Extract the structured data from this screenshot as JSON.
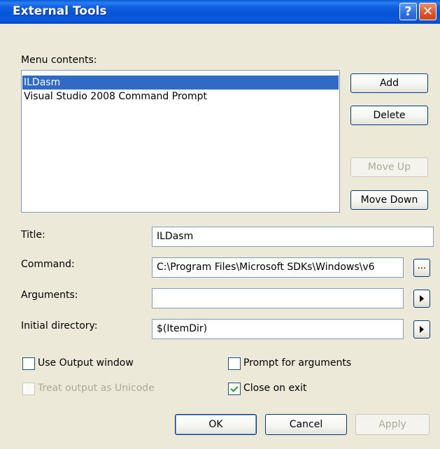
{
  "window": {
    "title": "External Tools"
  },
  "titlebar": {
    "help_glyph": "?",
    "close_glyph": "✕"
  },
  "menu_contents": {
    "label": "Menu contents:",
    "items": [
      {
        "label": "ILDasm",
        "selected": true
      },
      {
        "label": "Visual Studio 2008 Command Prompt",
        "selected": false
      }
    ]
  },
  "side_buttons": {
    "add": "Add",
    "delete": "Delete",
    "move_up": "Move Up",
    "move_down": "Move Down"
  },
  "fields": {
    "title": {
      "label": "Title:",
      "value": "ILDasm"
    },
    "command": {
      "label": "Command:",
      "value": "C:\\Program Files\\Microsoft SDKs\\Windows\\v6"
    },
    "arguments": {
      "label": "Arguments:",
      "value": ""
    },
    "initial_directory": {
      "label": "Initial directory:",
      "value": "$(ItemDir)"
    }
  },
  "browse_button": "...",
  "options": {
    "use_output_window": {
      "label": "Use Output window",
      "checked": false,
      "enabled": true
    },
    "treat_output_unicode": {
      "label": "Treat output as Unicode",
      "checked": false,
      "enabled": false
    },
    "prompt_for_arguments": {
      "label": "Prompt for arguments",
      "checked": false,
      "enabled": true
    },
    "close_on_exit": {
      "label": "Close on exit",
      "checked": true,
      "enabled": true
    }
  },
  "footer": {
    "ok": "OK",
    "cancel": "Cancel",
    "apply": "Apply"
  },
  "colors": {
    "titlebar": "#0553d6",
    "selection": "#316ac5",
    "dialog_bg": "#ece9d8",
    "disabled_text": "#acaa99"
  },
  "icons": {
    "help": "help-icon",
    "close": "close-icon",
    "arguments_menu": "arrow-right-icon",
    "initial_directory_menu": "arrow-right-icon",
    "checkmark": "checkmark-icon"
  }
}
